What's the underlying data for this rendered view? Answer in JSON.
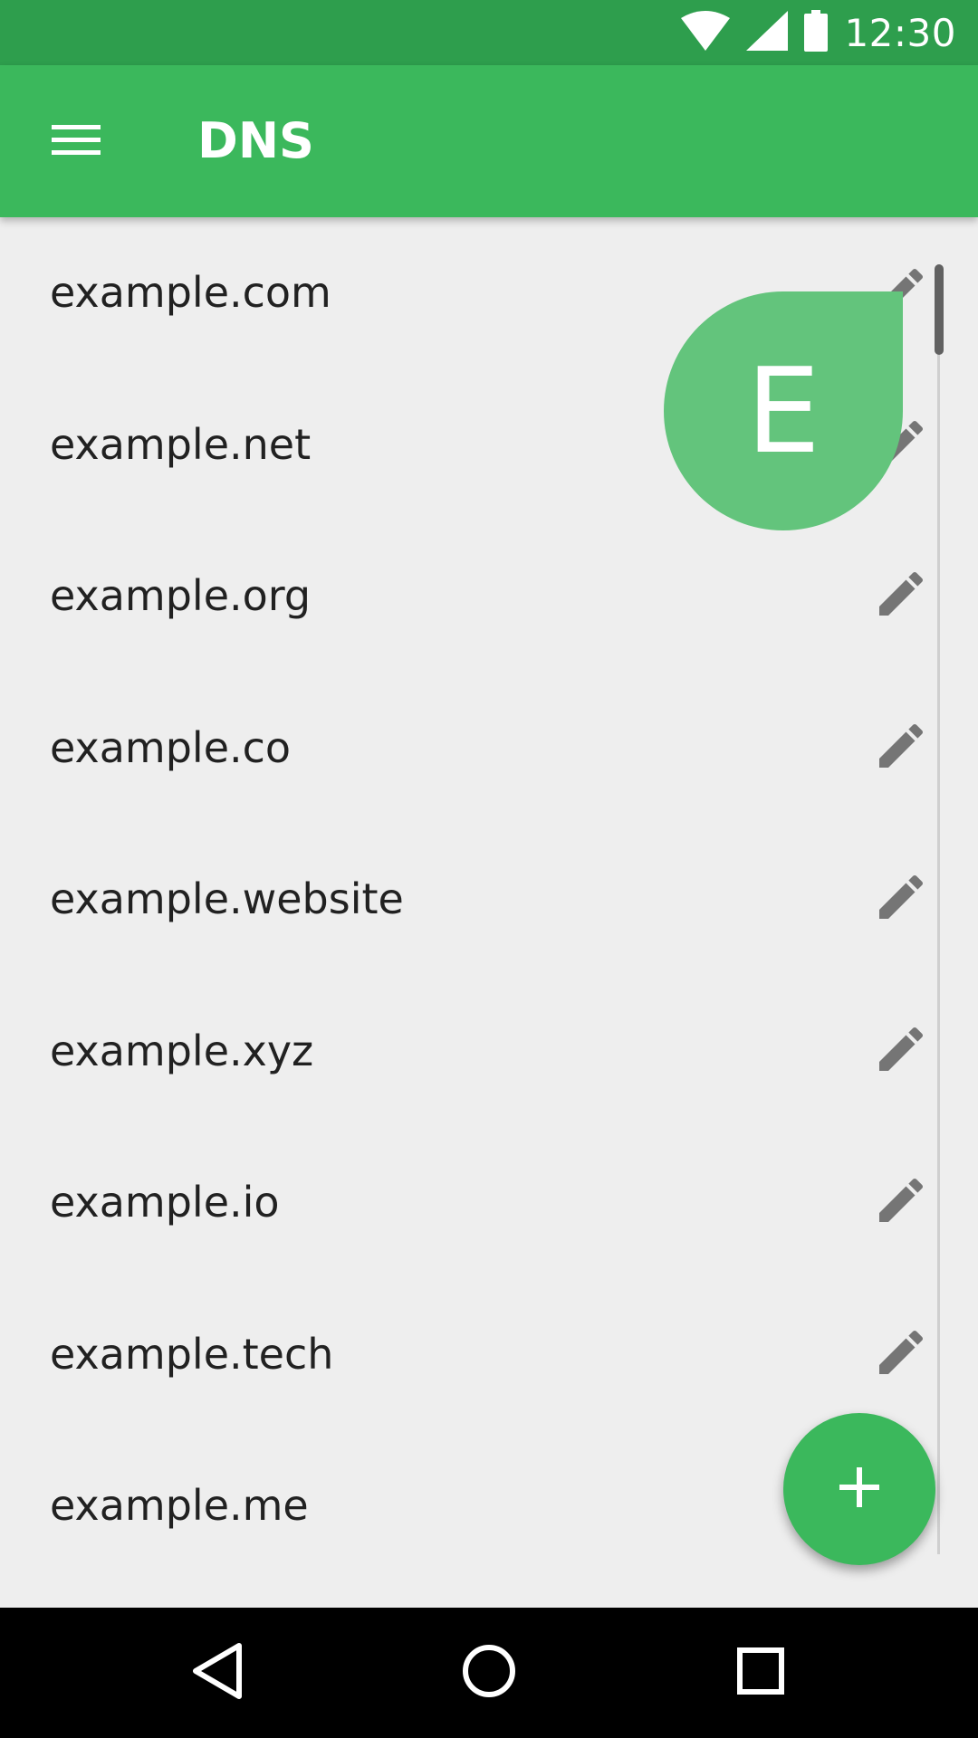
{
  "status_bar": {
    "time": "12:30",
    "icons": [
      "wifi-icon",
      "cell-signal-icon",
      "battery-icon"
    ]
  },
  "app_bar": {
    "title": "DNS",
    "menu_icon": "menu-icon"
  },
  "domains": [
    {
      "label": "example.com"
    },
    {
      "label": "example.net"
    },
    {
      "label": "example.org"
    },
    {
      "label": "example.co"
    },
    {
      "label": "example.website"
    },
    {
      "label": "example.xyz"
    },
    {
      "label": "example.io"
    },
    {
      "label": "example.tech"
    },
    {
      "label": "example.me"
    }
  ],
  "fast_scroll": {
    "letter": "E"
  },
  "fab": {
    "icon": "plus-icon"
  },
  "nav_bar": {
    "buttons": [
      "back-icon",
      "home-icon",
      "recents-icon"
    ]
  },
  "colors": {
    "status_bar": "#2e9e4d",
    "app_bar": "#3bb85c",
    "accent": "#3bb85c",
    "bubble": "#63c47c",
    "background": "#eeeeee",
    "edit_icon": "#757575"
  }
}
